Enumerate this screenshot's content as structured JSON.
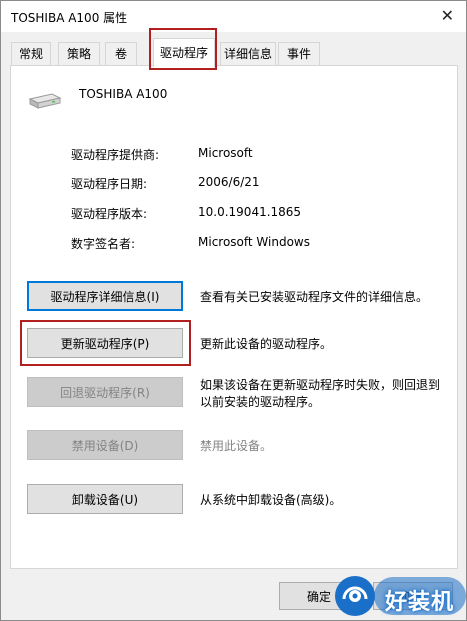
{
  "window": {
    "title": "TOSHIBA A100 属性",
    "close_glyph": "✕"
  },
  "tabs": [
    {
      "label": "常规"
    },
    {
      "label": "策略"
    },
    {
      "label": "卷"
    },
    {
      "label": "驱动程序"
    },
    {
      "label": "详细信息"
    },
    {
      "label": "事件"
    }
  ],
  "active_tab": "驱动程序",
  "device": {
    "name": "TOSHIBA A100",
    "icon": "drive-icon"
  },
  "info": [
    {
      "label": "驱动程序提供商:",
      "value": "Microsoft"
    },
    {
      "label": "驱动程序日期:",
      "value": "2006/6/21"
    },
    {
      "label": "驱动程序版本:",
      "value": "10.0.19041.1865"
    },
    {
      "label": "数字签名者:",
      "value": "Microsoft Windows"
    }
  ],
  "actions": [
    {
      "label": "驱动程序详细信息(I)",
      "desc": "查看有关已安装驱动程序文件的详细信息。",
      "enabled": true
    },
    {
      "label": "更新驱动程序(P)",
      "desc": "更新此设备的驱动程序。",
      "enabled": true
    },
    {
      "label": "回退驱动程序(R)",
      "desc": "如果该设备在更新驱动程序时失败，则回退到以前安装的驱动程序。",
      "enabled": false
    },
    {
      "label": "禁用设备(D)",
      "desc": "禁用此设备。",
      "enabled": false
    },
    {
      "label": "卸载设备(U)",
      "desc": "从系统中卸载设备(高级)。",
      "enabled": true
    }
  ],
  "footer": {
    "ok_label": "确定",
    "cancel_label": "取消"
  },
  "watermark": {
    "text": "好装机"
  },
  "colors": {
    "highlight": "#b21f1f",
    "focus": "#0078d7",
    "watermark": "#1a6fc9"
  }
}
